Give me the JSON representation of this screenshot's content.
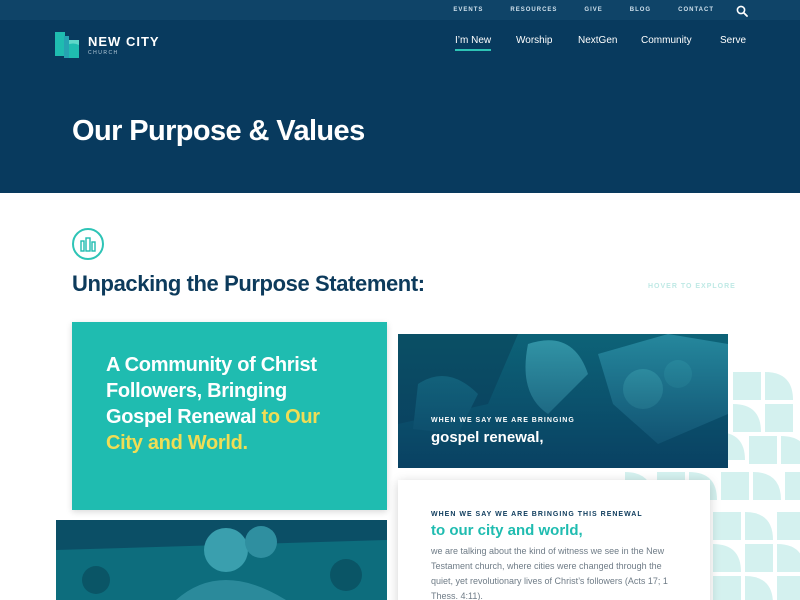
{
  "utility_nav": {
    "links": [
      "EVENTS",
      "RESOURCES",
      "GIVE",
      "BLOG",
      "CONTACT"
    ],
    "search_icon": "search-icon"
  },
  "logo": {
    "name": "NEW CITY",
    "sub": "CHURCH",
    "mark_icon": "new-city-logo-icon"
  },
  "main_nav": {
    "items": [
      {
        "label": "I’m New",
        "active": true
      },
      {
        "label": "Worship",
        "active": false
      },
      {
        "label": "NextGen",
        "active": false
      },
      {
        "label": "Community",
        "active": false
      },
      {
        "label": "Serve",
        "active": false
      }
    ]
  },
  "hero": {
    "title": "Our Purpose & Values"
  },
  "section": {
    "icon": "city-buildings-icon",
    "heading": "Unpacking the Purpose Statement:",
    "hover_hint": "HOVER TO EXPLORE"
  },
  "purpose_card": {
    "text_main": "A Community of Christ Followers, Bringing Gospel Renewal",
    "text_highlight": " to Our City and World."
  },
  "photo_card": {
    "kicker": "WHEN WE SAY WE ARE BRINGING",
    "title": "gospel renewal,"
  },
  "text_card": {
    "kicker": "WHEN WE SAY WE ARE BRINGING THIS RENEWAL",
    "title": "to our city and world,",
    "body": "we are talking about the kind of witness we see in the New Testament church, where cities were changed through the quiet, yet revolutionary lives of Christ’s followers (Acts 17; 1 Thess. 4:11)."
  },
  "colors": {
    "navy": "#083a5e",
    "teal": "#1fbcb0",
    "yellow": "#f0dd55",
    "light_teal": "#d4f1ef"
  }
}
